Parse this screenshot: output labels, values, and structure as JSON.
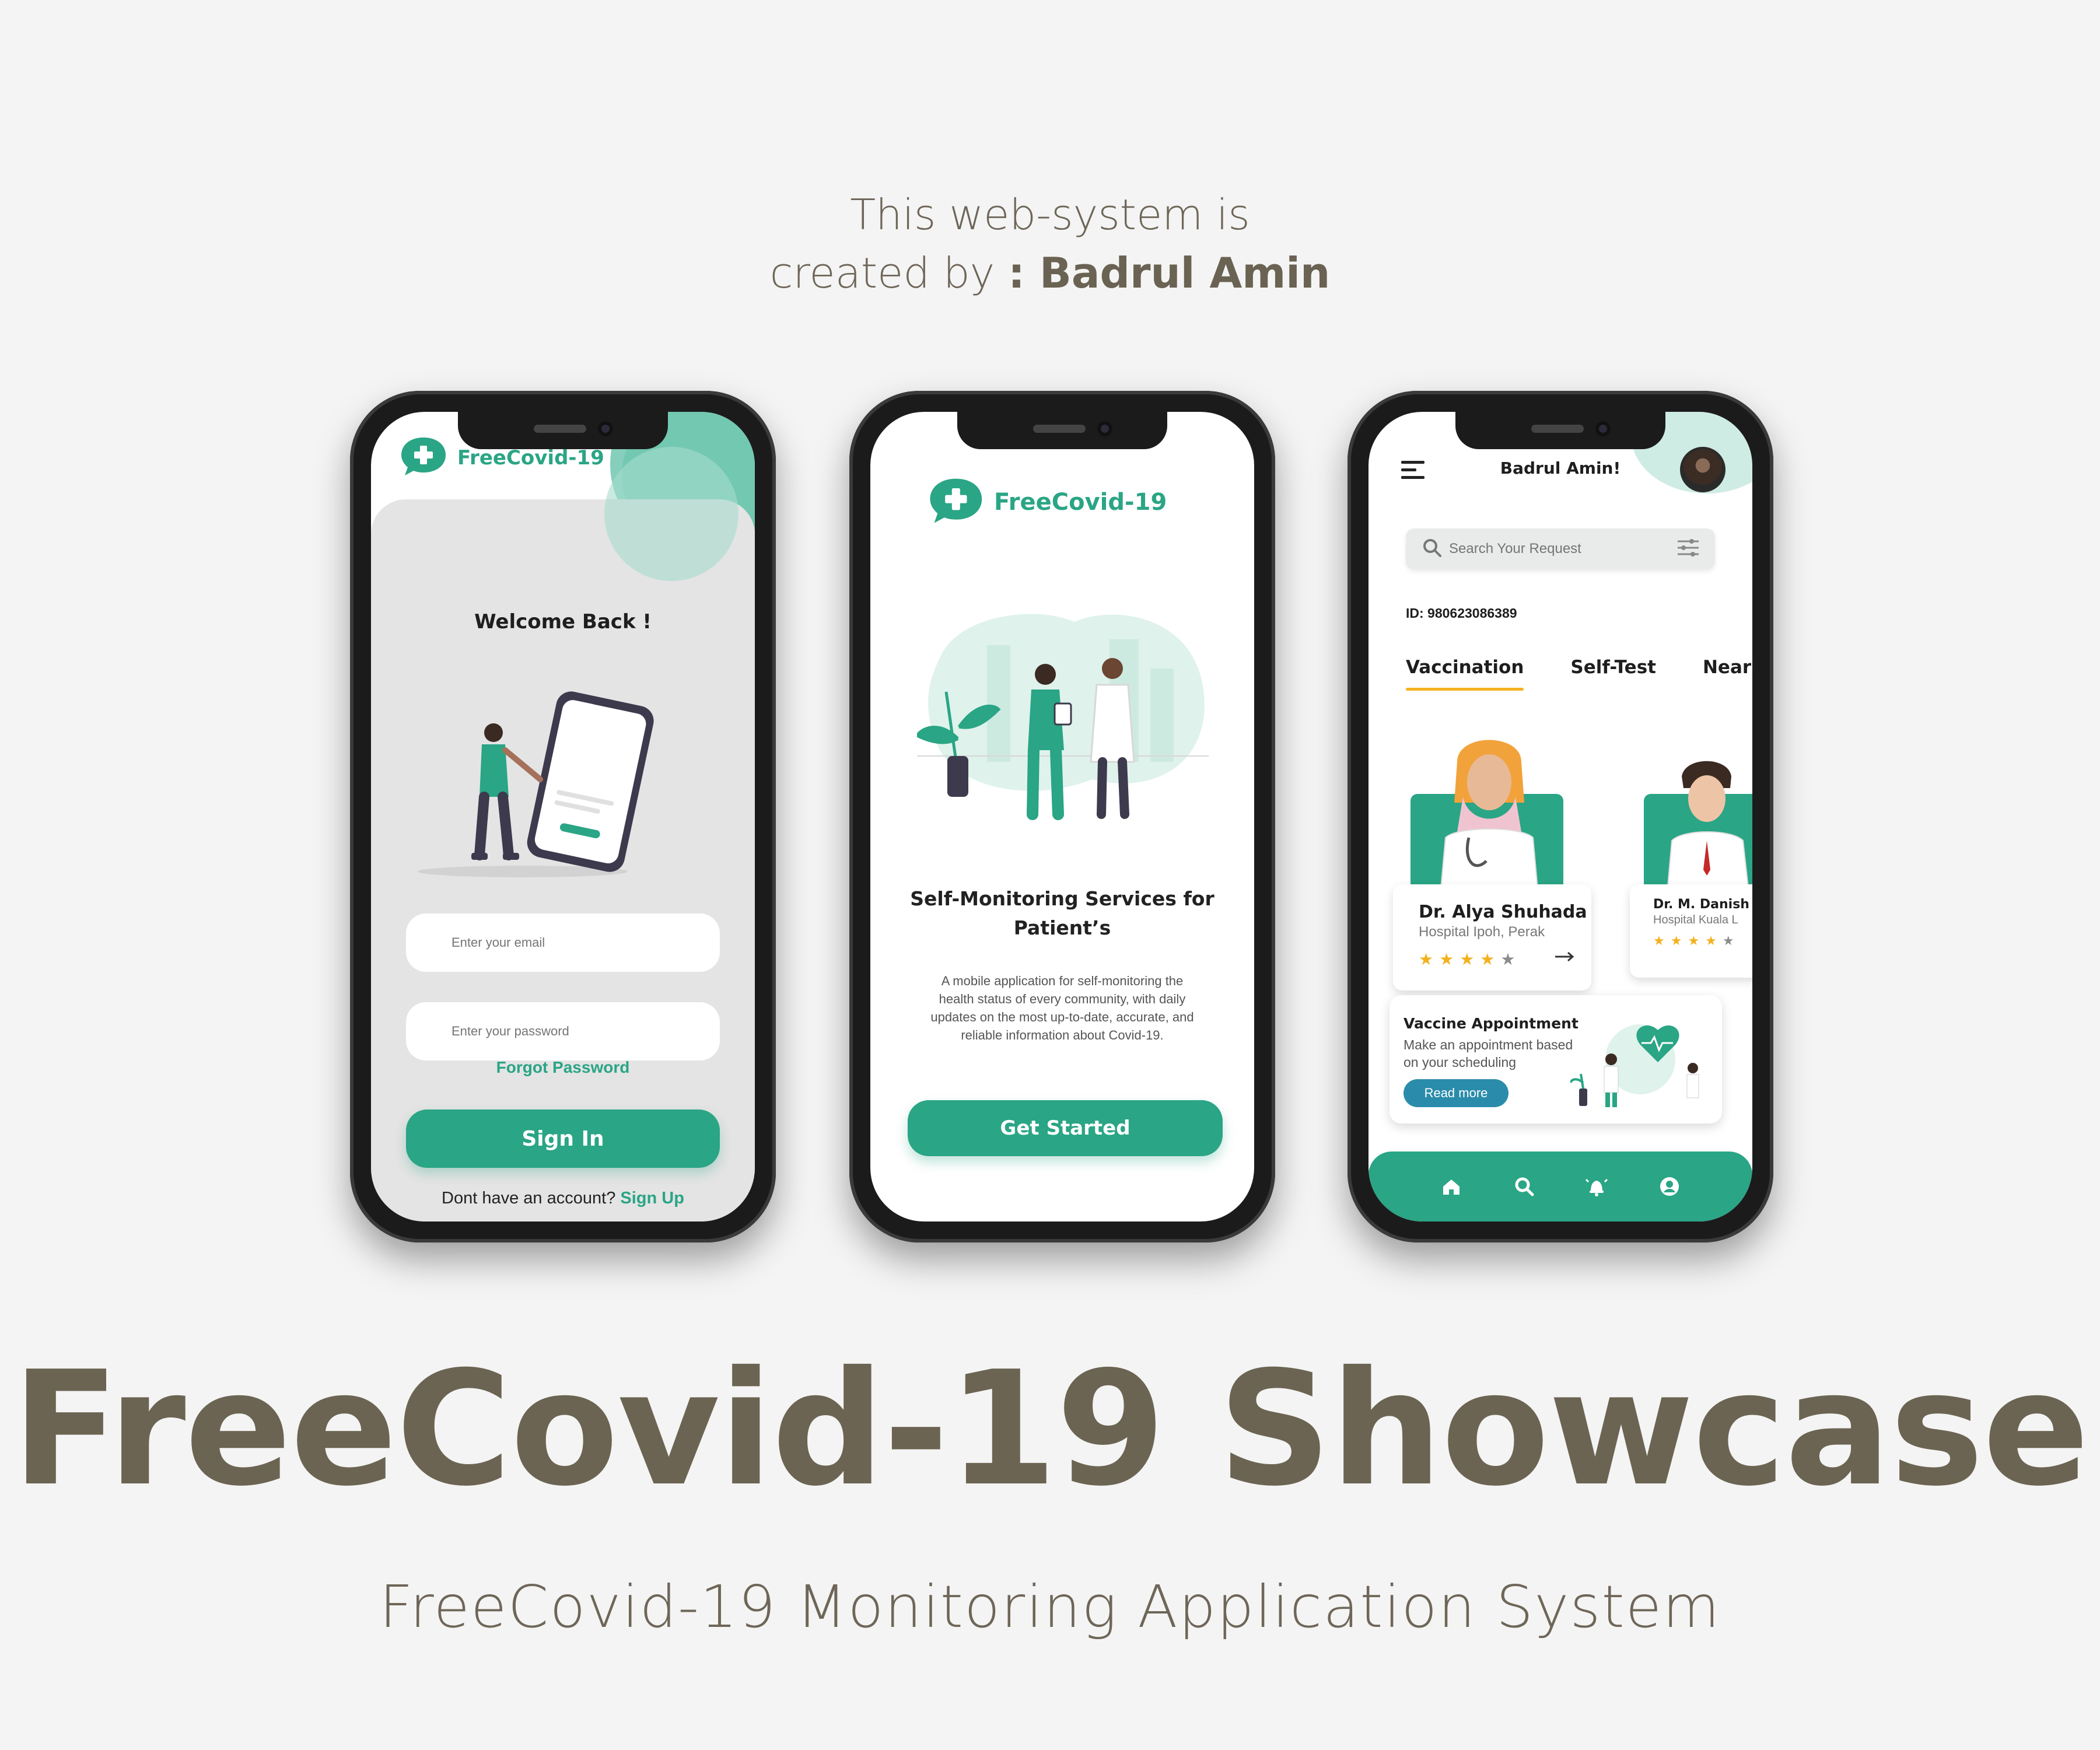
{
  "credit": {
    "line1": "This web-system is",
    "line2_prefix": "created by ",
    "line2_author": ": Badrul Amin"
  },
  "showcase": {
    "title": "FreeCovid-19 Showcase",
    "subtitle": "FreeCovid-19 Monitoring Application System"
  },
  "colors": {
    "brand_green": "#2aa585",
    "title_brown": "#6b6452",
    "star_yellow": "#f4b11f",
    "read_more_blue": "#2a8caa"
  },
  "login_screen": {
    "brand": "FreeCovid-19",
    "welcome": "Welcome Back !",
    "email_placeholder": "Enter your email",
    "password_placeholder": "Enter your password",
    "forgot_password": "Forgot Password",
    "sign_in": "Sign In",
    "no_account": "Dont have an account?",
    "sign_up": "Sign Up"
  },
  "onboarding_screen": {
    "brand": "FreeCovid-19",
    "headline": "Self-Monitoring Services for Patient’s",
    "description": "A mobile application for self-monitoring the health status of every community, with daily updates on the most up-to-date, accurate, and reliable information about Covid-19.",
    "get_started": "Get Started"
  },
  "home_screen": {
    "greeting": "Badrul Amin!",
    "search_placeholder": "Search Your Request",
    "user_id": "ID: 980623086389",
    "tabs": [
      {
        "label": "Vaccination",
        "active": true
      },
      {
        "label": "Self-Test",
        "active": false
      },
      {
        "label": "Nearby",
        "active": false
      }
    ],
    "doctors": [
      {
        "name": "Dr. Alya Shuhada",
        "hospital": "Hospital Ipoh, Perak",
        "rating": 4,
        "max": 5
      },
      {
        "name": "Dr. M. Danish",
        "hospital": "Hospital Kuala L",
        "rating": 4,
        "max": 5
      }
    ],
    "appointment": {
      "title": "Vaccine Appointment",
      "description": "Make an appointment based on your scheduling",
      "read_more": "Read more"
    },
    "nav_icons": [
      "home-icon",
      "search-icon",
      "bell-icon",
      "user-icon"
    ]
  }
}
